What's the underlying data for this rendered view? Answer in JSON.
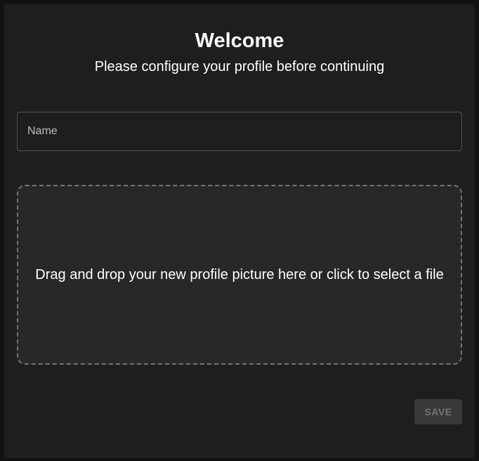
{
  "dialog": {
    "title": "Welcome",
    "subtitle": "Please configure your profile before continuing"
  },
  "name_field": {
    "placeholder": "Name",
    "value": ""
  },
  "dropzone": {
    "text": "Drag and drop your new profile picture here or click to select a file"
  },
  "actions": {
    "save_label": "SAVE",
    "save_disabled": true
  },
  "colors": {
    "background": "#1e1e1e",
    "dropzone_background": "#282828",
    "text": "#ffffff"
  }
}
